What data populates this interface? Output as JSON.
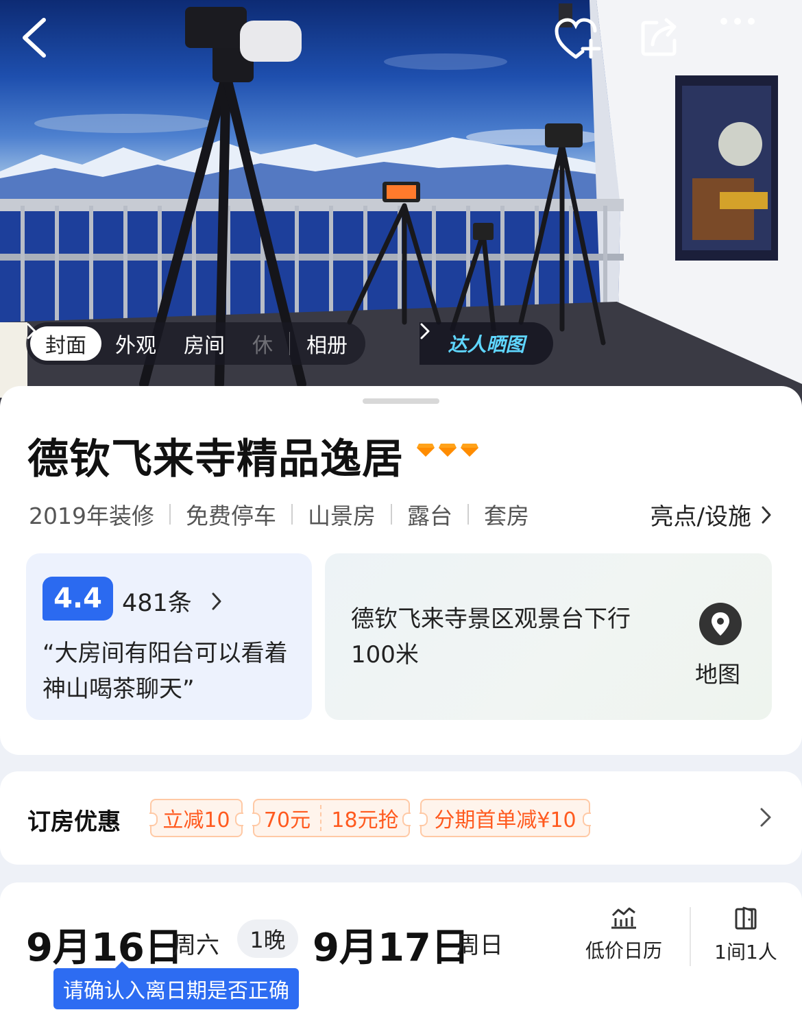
{
  "hero": {
    "photo_tabs": [
      "封面",
      "外观",
      "房间",
      "休"
    ],
    "album_label": "相册",
    "expert_label": "达人晒图"
  },
  "hotel": {
    "name": "德钦飞来寺精品逸居",
    "diamond_count": 3,
    "diamond_color": "#ffa21a",
    "tags": [
      "2019年装修",
      "免费停车",
      "山景房",
      "露台",
      "套房"
    ],
    "highlights_label": "亮点/设施"
  },
  "review": {
    "score": "4.4",
    "count": "481条",
    "quote": "“大房间有阳台可以看着神山喝茶聊天”"
  },
  "location": {
    "text": "德钦飞来寺景区观景台下行100米",
    "map_label": "地图"
  },
  "offers": {
    "title": "订房优惠",
    "coupon1": "立减10",
    "coupon2_left": "70元",
    "coupon2_right": "18元抢",
    "coupon3": "分期首单减¥10",
    "accent_color": "#ff5a1f"
  },
  "dates": {
    "checkin": "9月16日",
    "checkin_weekday": "周六",
    "nights": "1晚",
    "checkout": "9月17日",
    "checkout_weekday": "周日",
    "tooltip": "请确认入离日期是否正确",
    "calendar_label": "低价日历",
    "rooms_label": "1间1人"
  },
  "icons": {
    "back": "back-arrow-icon",
    "favorite": "heart-plus-icon",
    "share": "share-icon",
    "more": "more-dots-icon",
    "map": "location-pin-icon",
    "calendar": "price-chart-icon",
    "rooms": "door-icon"
  }
}
